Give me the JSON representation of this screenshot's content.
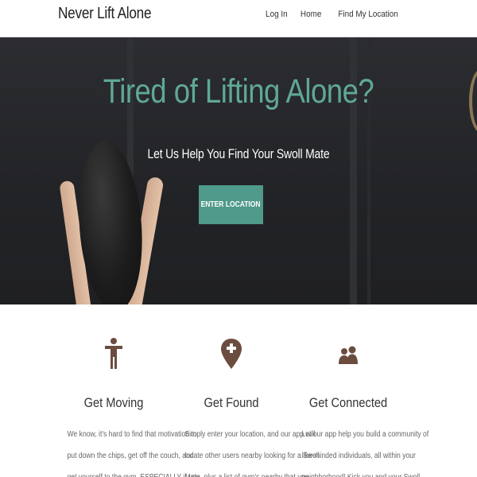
{
  "navbar": {
    "brand": "Never Lift Alone",
    "links": [
      "Log In",
      "Home",
      "Find My Location"
    ]
  },
  "hero": {
    "title": "Tired of Lifting Alone?",
    "subtitle": "Let Us Help You Find Your Swoll Mate",
    "cta_label": "ENTER LOCATION"
  },
  "features": [
    {
      "icon": "person-standing-icon",
      "title": "Get Moving",
      "lines": [
        "We know, it's hard to find that motivation to",
        "put down the chips, get off the couch, and",
        "get yourself to the gym. ESPECIALLY if you"
      ]
    },
    {
      "icon": "map-pin-plus-icon",
      "title": "Get Found",
      "lines": [
        "Simply enter your location, and our app will",
        "locate other users nearby looking for a Swoll",
        "Mate, plus a list of gym's nearby that you"
      ]
    },
    {
      "icon": "people-icon",
      "title": "Get Connected",
      "lines": [
        "Let our app help you build a community of",
        "like-minded individuals, all within your",
        "neighborhood! Kick you and your Swoll"
      ]
    }
  ],
  "colors": {
    "accent": "#4f9a8a",
    "title_teal": "#5fa898",
    "icon_brown": "#6b4d3f"
  }
}
